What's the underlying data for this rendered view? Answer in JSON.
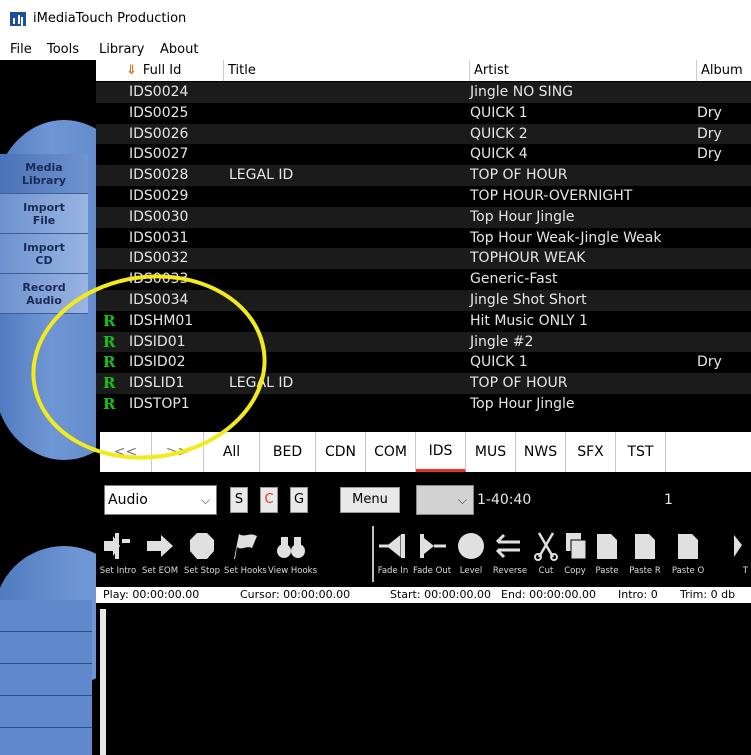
{
  "window": {
    "title": "iMediaTouch Production"
  },
  "menu": [
    "File",
    "Tools",
    "Library",
    "About"
  ],
  "sidebar": {
    "items": [
      {
        "line1": "Media",
        "line2": "Library"
      },
      {
        "line1": "Import",
        "line2": "File"
      },
      {
        "line1": "Import",
        "line2": "CD"
      },
      {
        "line1": "Record",
        "line2": "Audio"
      }
    ]
  },
  "table": {
    "sort_icon": "down-arrow-icon",
    "headers": [
      "Full Id",
      "Title",
      "Artist",
      "Album"
    ],
    "rows": [
      {
        "flag": "",
        "id": "IDS0024",
        "title": "",
        "artist": "Jingle NO SING",
        "album": ""
      },
      {
        "flag": "",
        "id": "IDS0025",
        "title": "",
        "artist": "QUICK 1",
        "album": "Dry"
      },
      {
        "flag": "",
        "id": "IDS0026",
        "title": "",
        "artist": "QUICK 2",
        "album": "Dry"
      },
      {
        "flag": "",
        "id": "IDS0027",
        "title": "",
        "artist": "QUICK 4",
        "album": "Dry"
      },
      {
        "flag": "",
        "id": "IDS0028",
        "title": "LEGAL ID",
        "artist": "TOP OF HOUR",
        "album": ""
      },
      {
        "flag": "",
        "id": "IDS0029",
        "title": "",
        "artist": "TOP HOUR-OVERNIGHT",
        "album": ""
      },
      {
        "flag": "",
        "id": "IDS0030",
        "title": "",
        "artist": "Top Hour Jingle",
        "album": ""
      },
      {
        "flag": "",
        "id": "IDS0031",
        "title": "",
        "artist": "Top Hour Weak-Jingle Weak",
        "album": ""
      },
      {
        "flag": "",
        "id": "IDS0032",
        "title": "",
        "artist": "TOPHOUR WEAK",
        "album": ""
      },
      {
        "flag": "",
        "id": "IDS0033",
        "title": "",
        "artist": "Generic-Fast",
        "album": ""
      },
      {
        "flag": "",
        "id": "IDS0034",
        "title": "",
        "artist": "Jingle Shot Short",
        "album": ""
      },
      {
        "flag": "R",
        "id": "IDSHM01",
        "title": "",
        "artist": "Hit Music ONLY 1",
        "album": ""
      },
      {
        "flag": "R",
        "id": "IDSID01",
        "title": "",
        "artist": "Jingle #2",
        "album": ""
      },
      {
        "flag": "R",
        "id": "IDSID02",
        "title": "",
        "artist": "QUICK 1",
        "album": "Dry"
      },
      {
        "flag": "R",
        "id": "IDSLID1",
        "title": "LEGAL ID",
        "artist": "TOP OF HOUR",
        "album": ""
      },
      {
        "flag": "R",
        "id": "IDSTOP1",
        "title": "",
        "artist": "Top Hour Jingle",
        "album": ""
      }
    ]
  },
  "category_tabs": [
    "<<",
    ">>",
    "All",
    "BED",
    "CDN",
    "COM",
    "IDS",
    "MUS",
    "NWS",
    "SFX",
    "TST"
  ],
  "category_active": "IDS",
  "controls": {
    "type_select": "Audio",
    "s_label": "S",
    "c_label": "C",
    "g_label": "G",
    "menu_label": "Menu",
    "secondary_select": "",
    "range": "1-40:40",
    "count": "1"
  },
  "tools": [
    {
      "label": "Set Intro",
      "icon": "set-intro-icon"
    },
    {
      "label": "Set EOM",
      "icon": "set-eom-icon"
    },
    {
      "label": "Set Stop",
      "icon": "stop-octagon-icon"
    },
    {
      "label": "Set Hooks",
      "icon": "flag-icon"
    },
    {
      "label": "View Hooks",
      "icon": "binoculars-icon"
    },
    {
      "label": "Fade In",
      "icon": "fade-in-icon"
    },
    {
      "label": "Fade Out",
      "icon": "fade-out-icon"
    },
    {
      "label": "Level",
      "icon": "level-circle-icon"
    },
    {
      "label": "Reverse",
      "icon": "reverse-icon"
    },
    {
      "label": "Cut",
      "icon": "scissors-icon"
    },
    {
      "label": "Copy",
      "icon": "copy-icon"
    },
    {
      "label": "Paste",
      "icon": "paste-icon"
    },
    {
      "label": "Paste R",
      "icon": "paste-r-icon"
    },
    {
      "label": "Paste O",
      "icon": "paste-o-icon"
    },
    {
      "label": "T",
      "icon": "trim-icon"
    }
  ],
  "status": {
    "play": "Play: 00:00:00.00",
    "cursor": "Cursor: 00:00:00.00",
    "start": "Start: 00:00:00.00",
    "end": "End: 00:00:00.00",
    "intro": "Intro: 0",
    "trim": "Trim: 0 db"
  },
  "colors": {
    "accent_blue": "#5f89cc",
    "ready_flag": "#12c312",
    "active_tab_underline": "#e8332b",
    "annotation_circle": "#f2ea1a"
  }
}
